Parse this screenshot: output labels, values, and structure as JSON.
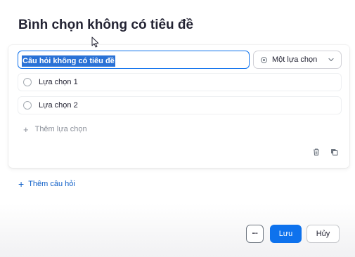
{
  "poll": {
    "title": "Bình chọn không có tiêu đề",
    "question_text": "Câu hỏi không có tiêu đề",
    "answer_type": "Một lựa chọn",
    "options": [
      {
        "label": "Lựa chọn 1"
      },
      {
        "label": "Lựa chọn 2"
      }
    ],
    "add_option_label": "Thêm lựa chọn",
    "add_question_label": "Thêm câu hỏi"
  },
  "footer": {
    "more_label": "···",
    "save_label": "Lưu",
    "cancel_label": "Hủy"
  },
  "icons": {
    "delete": "trash-icon",
    "duplicate": "copy-icon",
    "dropdown": "chevron-down-icon",
    "cursor": "mouse-pointer-icon"
  },
  "colors": {
    "accent": "#0e72ed",
    "selection": "#2a72d6",
    "link": "#0e5fc8"
  }
}
